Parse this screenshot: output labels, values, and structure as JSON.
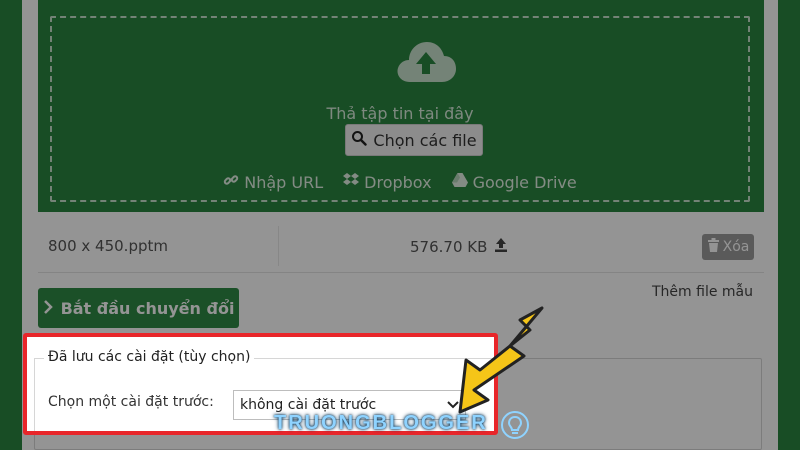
{
  "dropzone": {
    "drop_text": "Thả tập tin tại đây",
    "choose_label": "Chọn các file",
    "links": [
      {
        "label": "Nhập URL",
        "icon": "link-icon"
      },
      {
        "label": "Dropbox",
        "icon": "dropbox-icon"
      },
      {
        "label": "Google Drive",
        "icon": "google-drive-icon"
      }
    ]
  },
  "file": {
    "name": "800 x 450.pptm",
    "size": "576.70 KB",
    "delete_label": "Xóa"
  },
  "actions": {
    "add_sample": "Thêm file mẫu",
    "start_label": "Bắt đầu chuyển đổi"
  },
  "settings": {
    "legend": "Đã lưu các cài đặt (tùy chọn)",
    "preset_label": "Chọn một cài đặt trước:",
    "preset_value": "không cài đặt trước"
  },
  "watermark": {
    "text": "TRUONGBLOGGER"
  },
  "colors": {
    "brand_green": "#2a8540",
    "highlight_red": "#e8262a",
    "arrow_yellow": "#f5c518"
  }
}
